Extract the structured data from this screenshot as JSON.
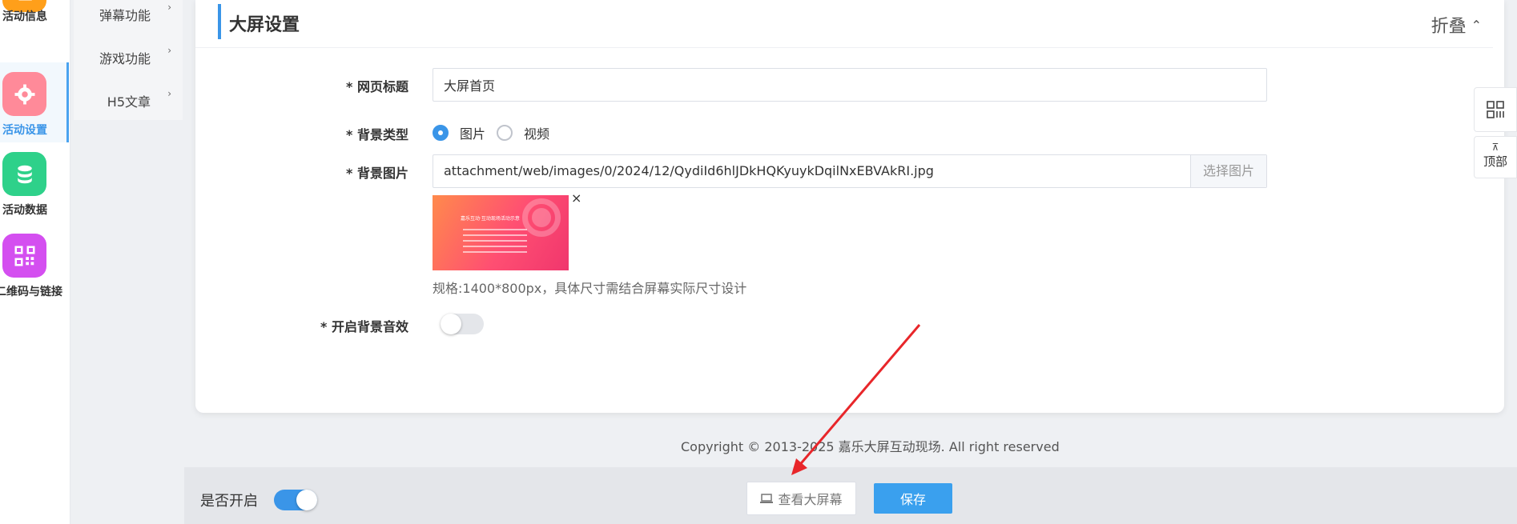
{
  "nav": {
    "items": [
      {
        "label": "活动信息",
        "icon": "document-icon",
        "color": "#ff9f1a"
      },
      {
        "label": "活动设置",
        "icon": "gear-icon",
        "color": "#ff8a99"
      },
      {
        "label": "活动数据",
        "icon": "database-icon",
        "color": "#2ed18a"
      },
      {
        "label": "二维码与链接",
        "icon": "qrcode-icon",
        "color": "#d44ff0"
      }
    ],
    "active_index": 1
  },
  "submenu": {
    "items": [
      {
        "label": "弹幕功能",
        "arrow": "›"
      },
      {
        "label": "游戏功能",
        "arrow": "›"
      },
      {
        "label": "H5文章",
        "arrow": "›"
      }
    ]
  },
  "panel": {
    "title": "大屏设置",
    "collapse_label": "折叠",
    "collapse_icon": "⌃"
  },
  "form": {
    "page_title_label": "* 网页标题",
    "page_title_value": "大屏首页",
    "bg_type_label": "* 背景类型",
    "bg_type_options": [
      "图片",
      "视频"
    ],
    "bg_type_selected": "图片",
    "bg_image_label": "* 背景图片",
    "bg_image_value": "attachment/web/images/0/2024/12/QydiId6hlJDkHQKyuykDqilNxEBVAkRI.jpg",
    "bg_image_button": "选择图片",
    "thumbnail_remove": "×",
    "thumbnail_text": "嘉乐互动·互动现场活动示意",
    "hint": "规格:1400*800px，具体尺寸需结合屏幕实际尺寸设计",
    "bg_music_label": "* 开启背景音效",
    "bg_music_enabled": false
  },
  "copyright": "Copyright © 2013-2025 嘉乐大屏互动现场. All right reserved",
  "footer": {
    "enable_label": "是否开启",
    "enabled": true,
    "preview_label": "查看大屏幕",
    "save_label": "保存"
  },
  "tools": {
    "top_label": "顶部",
    "top_icon": "⊼"
  },
  "colors": {
    "accent": "#3a95e8",
    "annotation_arrow": "#e8262a"
  }
}
